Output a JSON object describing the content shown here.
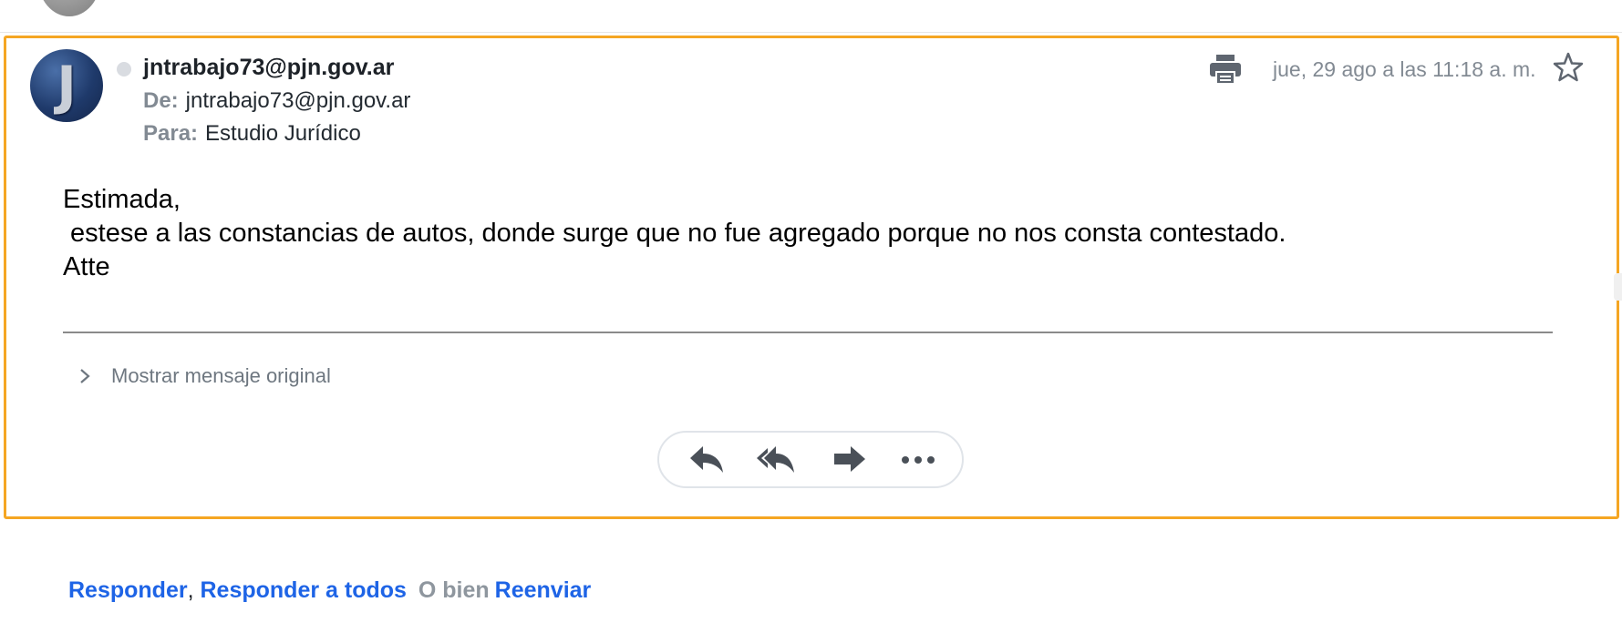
{
  "message": {
    "avatar_letter": "J",
    "sender_name": "jntrabajo73@pjn.gov.ar",
    "from_label": "De:",
    "from_value": "jntrabajo73@pjn.gov.ar",
    "to_label": "Para:",
    "to_value": "Estudio Jurídico",
    "date": "jue, 29 ago a las 11:18 a. m.",
    "body": "Estimada,\n estese a las constancias de autos, donde surge que no fue agregado porque no nos consta contestado.\nAtte",
    "show_original_label": "Mostrar mensaje original",
    "highlight_color": "#f5a623"
  },
  "actions": {
    "reply_icon": "reply-icon",
    "reply_all_icon": "reply-all-icon",
    "forward_icon": "forward-icon",
    "more_icon": "more-horizontal-icon"
  },
  "footer": {
    "reply_label": "Responder",
    "comma": ",",
    "reply_all_label": "Responder a todos",
    "or_label": "O bien",
    "forward_label": "Reenviar",
    "link_color": "#1e64e6"
  }
}
